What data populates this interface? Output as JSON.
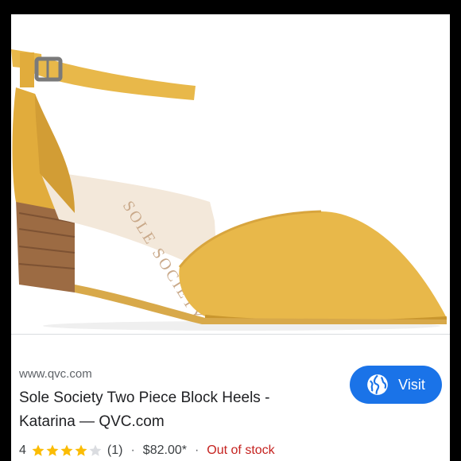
{
  "result": {
    "source_domain": "www.qvc.com",
    "title_line1": "Sole Society Two Piece Block Heels -",
    "title_line2": "Katarina — QVC.com",
    "visit_label": "Visit",
    "rating_value": "4",
    "rating_stars": 4,
    "rating_max": 5,
    "review_count": "(1)",
    "separator": "·",
    "price": "$82.00*",
    "stock_status": "Out of stock"
  },
  "image": {
    "insole_logo_text": "SOLE SOCIETY",
    "colors": {
      "suede": "#e8b84a",
      "suede_shadow": "#c9962e",
      "lining": "#f3e8da",
      "heel": "#9c6b43",
      "buckle": "#7a7a7a"
    }
  },
  "colors": {
    "accent": "#1a73e8",
    "star": "#fbbc04",
    "star_empty": "#dadce0",
    "stock_status": "#c5221f"
  },
  "icons": {
    "visit_icon": "globe-icon",
    "rating_icon": "star-icon"
  }
}
